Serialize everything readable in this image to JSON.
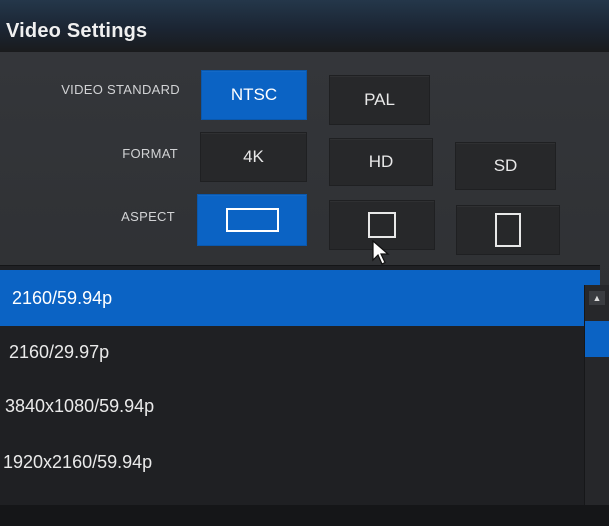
{
  "window": {
    "title": "Video Settings"
  },
  "video_standard": {
    "label": "VIDEO STANDARD",
    "options": [
      "NTSC",
      "PAL"
    ],
    "selected": "NTSC"
  },
  "format": {
    "label": "FORMAT",
    "options": [
      "4K",
      "HD",
      "SD"
    ]
  },
  "aspect": {
    "label": "ASPECT",
    "options": [
      "widescreen-aspect-icon",
      "square-aspect-icon",
      "portrait-aspect-icon"
    ],
    "selected": "widescreen-aspect-icon"
  },
  "modes": {
    "items": [
      "2160/59.94p",
      "2160/29.97p",
      "3840x1080/59.94p",
      "1920x2160/59.94p"
    ],
    "selected": "2160/59.94p"
  },
  "colors": {
    "accent": "#0b63c4",
    "panel": "#2e3033",
    "button": "#27282a"
  },
  "icons": {
    "scroll_up": "chevron-up-icon",
    "pointer": "mouse-pointer-icon"
  }
}
